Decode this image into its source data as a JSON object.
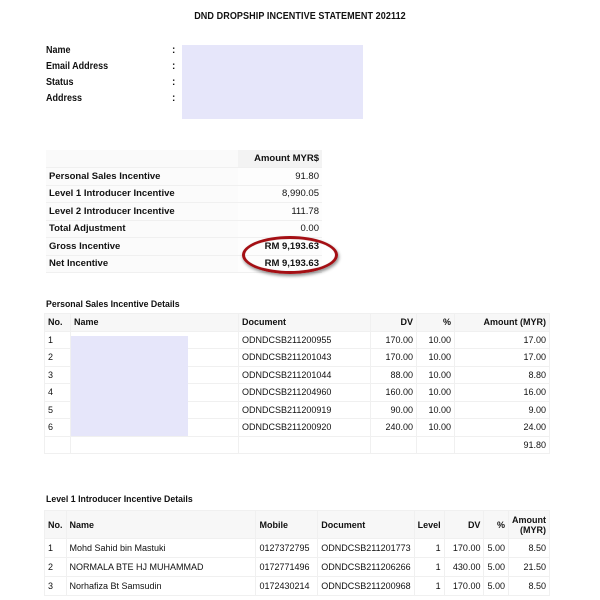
{
  "document": {
    "title": "DND DROPSHIP INCENTIVE STATEMENT 202112"
  },
  "profile": {
    "fields": [
      {
        "label": "Name",
        "colon": ":"
      },
      {
        "label": "Email Address",
        "colon": ":"
      },
      {
        "label": "Status",
        "colon": ":"
      },
      {
        "label": "Address",
        "colon": ":"
      }
    ],
    "redaction_color": "#e6e6fa"
  },
  "summary": {
    "header": "Amount MYR$",
    "rows": [
      {
        "label": "Personal Sales Incentive",
        "amount": "91.80"
      },
      {
        "label": "Level 1 Introducer Incentive",
        "amount": "8,990.05"
      },
      {
        "label": "Level 2 Introducer Incentive",
        "amount": "111.78"
      },
      {
        "label": "Total Adjustment",
        "amount": "0.00"
      },
      {
        "label": "Gross Incentive",
        "amount": "RM 9,193.63"
      },
      {
        "label": "Net Incentive",
        "amount": "RM 9,193.63"
      }
    ],
    "highlight_color": "#a40f14"
  },
  "personal_sales": {
    "title": "Personal Sales Incentive Details",
    "headers": {
      "no": "No.",
      "name": "Name",
      "document": "Document",
      "dv": "DV",
      "pct": "%",
      "amount": "Amount (MYR)"
    },
    "rows": [
      {
        "no": "1",
        "document": "ODNDCSB211200955",
        "dv": "170.00",
        "pct": "10.00",
        "amount": "17.00"
      },
      {
        "no": "2",
        "document": "ODNDCSB211201043",
        "dv": "170.00",
        "pct": "10.00",
        "amount": "17.00"
      },
      {
        "no": "3",
        "document": "ODNDCSB211201044",
        "dv": "88.00",
        "pct": "10.00",
        "amount": "8.80"
      },
      {
        "no": "4",
        "document": "ODNDCSB211204960",
        "dv": "160.00",
        "pct": "10.00",
        "amount": "16.00"
      },
      {
        "no": "5",
        "document": "ODNDCSB211200919",
        "dv": "90.00",
        "pct": "10.00",
        "amount": "9.00"
      },
      {
        "no": "6",
        "document": "ODNDCSB211200920",
        "dv": "240.00",
        "pct": "10.00",
        "amount": "24.00"
      }
    ],
    "total": "91.80"
  },
  "level1": {
    "title": "Level 1 Introducer Incentive Details",
    "headers": {
      "no": "No.",
      "name": "Name",
      "mobile": "Mobile",
      "document": "Document",
      "level": "Level",
      "dv": "DV",
      "pct": "%",
      "amount_line1": "Amount",
      "amount_line2": "(MYR)"
    },
    "rows": [
      {
        "no": "1",
        "name": "Mohd Sahid bin Mastuki",
        "mobile": "0127372795",
        "document": "ODNDCSB211201773",
        "level": "1",
        "dv": "170.00",
        "pct": "5.00",
        "amount": "8.50"
      },
      {
        "no": "2",
        "name": "NORMALA BTE HJ MUHAMMAD",
        "mobile": "0172771496",
        "document": "ODNDCSB211206266",
        "level": "1",
        "dv": "430.00",
        "pct": "5.00",
        "amount": "21.50"
      },
      {
        "no": "3",
        "name": "Norhafiza Bt Samsudin",
        "mobile": "0172430214",
        "document": "ODNDCSB211200968",
        "level": "1",
        "dv": "170.00",
        "pct": "5.00",
        "amount": "8.50"
      }
    ]
  }
}
